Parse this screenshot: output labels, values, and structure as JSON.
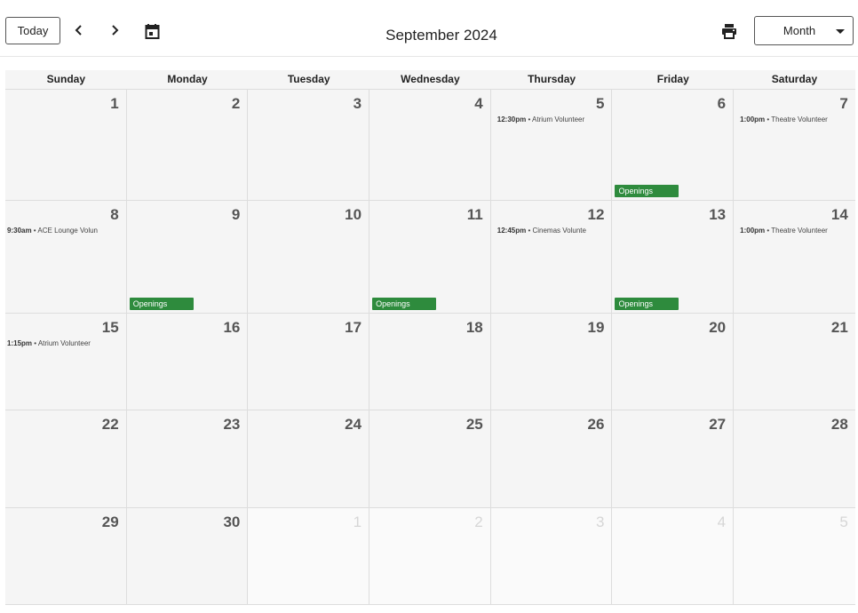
{
  "toolbar": {
    "today_label": "Today",
    "title": "September 2024",
    "view_label": "Month"
  },
  "weekdays": [
    "Sunday",
    "Monday",
    "Tuesday",
    "Wednesday",
    "Thursday",
    "Friday",
    "Saturday"
  ],
  "weeks": [
    {
      "days": [
        {
          "num": "1"
        },
        {
          "num": "2"
        },
        {
          "num": "3"
        },
        {
          "num": "4"
        },
        {
          "num": "5",
          "time": "12:30pm",
          "sep": " • ",
          "title": "Atrium Volunteer"
        },
        {
          "num": "6",
          "badge": "Openings"
        },
        {
          "num": "7",
          "time": "1:00pm",
          "sep": " • ",
          "title": "Theatre Volunteer"
        }
      ]
    },
    {
      "days": [
        {
          "num": "8",
          "time": "9:30am",
          "sep": " • ",
          "title": "ACE Lounge Volun"
        },
        {
          "num": "9",
          "badge": "Openings"
        },
        {
          "num": "10"
        },
        {
          "num": "11",
          "badge": "Openings"
        },
        {
          "num": "12",
          "time": "12:45pm",
          "sep": " • ",
          "title": "Cinemas Volunte"
        },
        {
          "num": "13",
          "badge": "Openings"
        },
        {
          "num": "14",
          "time": "1:00pm",
          "sep": " • ",
          "title": "Theatre Volunteer"
        }
      ]
    },
    {
      "days": [
        {
          "num": "15",
          "time": "1:15pm",
          "sep": " • ",
          "title": "Atrium Volunteer"
        },
        {
          "num": "16"
        },
        {
          "num": "17"
        },
        {
          "num": "18"
        },
        {
          "num": "19"
        },
        {
          "num": "20"
        },
        {
          "num": "21"
        }
      ]
    },
    {
      "days": [
        {
          "num": "22"
        },
        {
          "num": "23"
        },
        {
          "num": "24"
        },
        {
          "num": "25"
        },
        {
          "num": "26"
        },
        {
          "num": "27"
        },
        {
          "num": "28"
        }
      ]
    },
    {
      "days": [
        {
          "num": "29"
        },
        {
          "num": "30"
        },
        {
          "num": "1",
          "other": true
        },
        {
          "num": "2",
          "other": true
        },
        {
          "num": "3",
          "other": true
        },
        {
          "num": "4",
          "other": true
        },
        {
          "num": "5",
          "other": true
        }
      ]
    }
  ],
  "colors": {
    "openings_badge": "#2e8b3d",
    "cell_background": "#f5f5f5",
    "grid_line": "#dddddd"
  },
  "icons": {
    "prev": "chevron-left-icon",
    "next": "chevron-right-icon",
    "calendar": "calendar-icon",
    "print": "print-icon",
    "dropdown": "caret-down-icon"
  }
}
